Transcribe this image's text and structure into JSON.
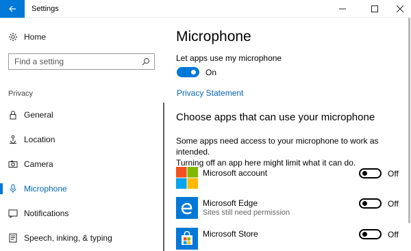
{
  "window": {
    "title": "Settings"
  },
  "sidebar": {
    "home_label": "Home",
    "search_placeholder": "Find a setting",
    "section_label": "Privacy",
    "items": [
      {
        "label": "General",
        "icon": "lock-icon"
      },
      {
        "label": "Location",
        "icon": "location-icon"
      },
      {
        "label": "Camera",
        "icon": "camera-icon"
      },
      {
        "label": "Microphone",
        "icon": "microphone-icon",
        "active": true
      },
      {
        "label": "Notifications",
        "icon": "notifications-icon"
      },
      {
        "label": "Speech, inking, & typing",
        "icon": "speech-icon"
      }
    ]
  },
  "main": {
    "title": "Microphone",
    "master_toggle": {
      "label": "Let apps use my microphone",
      "state": "On"
    },
    "privacy_link": "Privacy Statement",
    "section_title": "Choose apps that can use your microphone",
    "description_line1": "Some apps need access to your microphone to work as intended.",
    "description_line2": "Turning off an app here might limit what it can do.",
    "apps": [
      {
        "name": "Microsoft account",
        "subtitle": "",
        "state": "Off",
        "icon": "microsoft-logo-icon"
      },
      {
        "name": "Microsoft Edge",
        "subtitle": "Sites still need permission",
        "state": "Off",
        "icon": "edge-icon"
      },
      {
        "name": "Microsoft Store",
        "subtitle": "",
        "state": "Off",
        "icon": "store-icon"
      }
    ]
  },
  "colors": {
    "accent": "#0078d7",
    "link": "#0063b1",
    "ms_red": "#f25022",
    "ms_green": "#7fba00",
    "ms_blue": "#00a4ef",
    "ms_yellow": "#ffb900"
  }
}
